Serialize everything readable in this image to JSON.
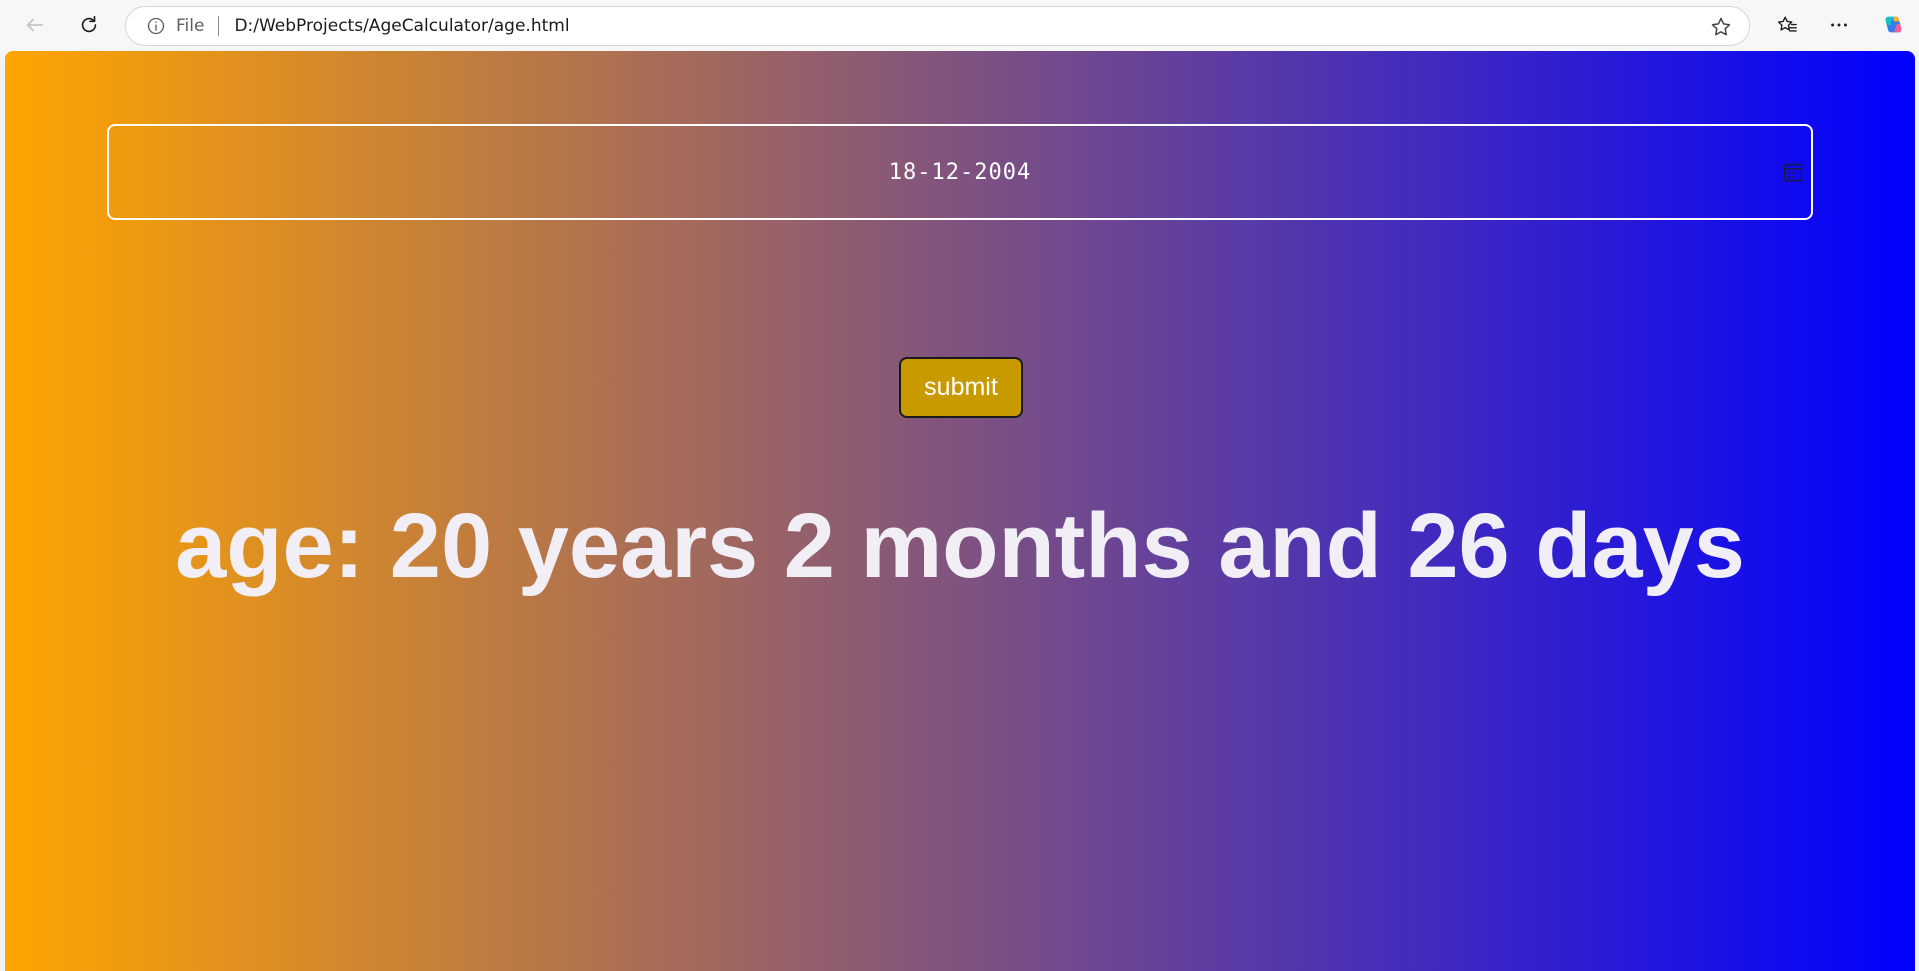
{
  "browser": {
    "scheme_label": "File",
    "url": "D:/WebProjects/AgeCalculator/age.html",
    "icons": {
      "back": "arrow-left-icon",
      "reload": "reload-icon",
      "info": "info-icon",
      "favorite": "star-icon",
      "favorites": "favorites-icon",
      "menu": "more-icon",
      "copilot": "copilot-icon"
    }
  },
  "page": {
    "date_input": {
      "value": "18-12-2004",
      "icon": "calendar-icon"
    },
    "submit_label": "submit",
    "result_text": "age: 20 years 2 months and 26 days",
    "colors": {
      "gradient_start": "#ffa500",
      "gradient_end": "#0000ff",
      "button_bg": "#c99a00",
      "text": "#ffffff"
    }
  }
}
